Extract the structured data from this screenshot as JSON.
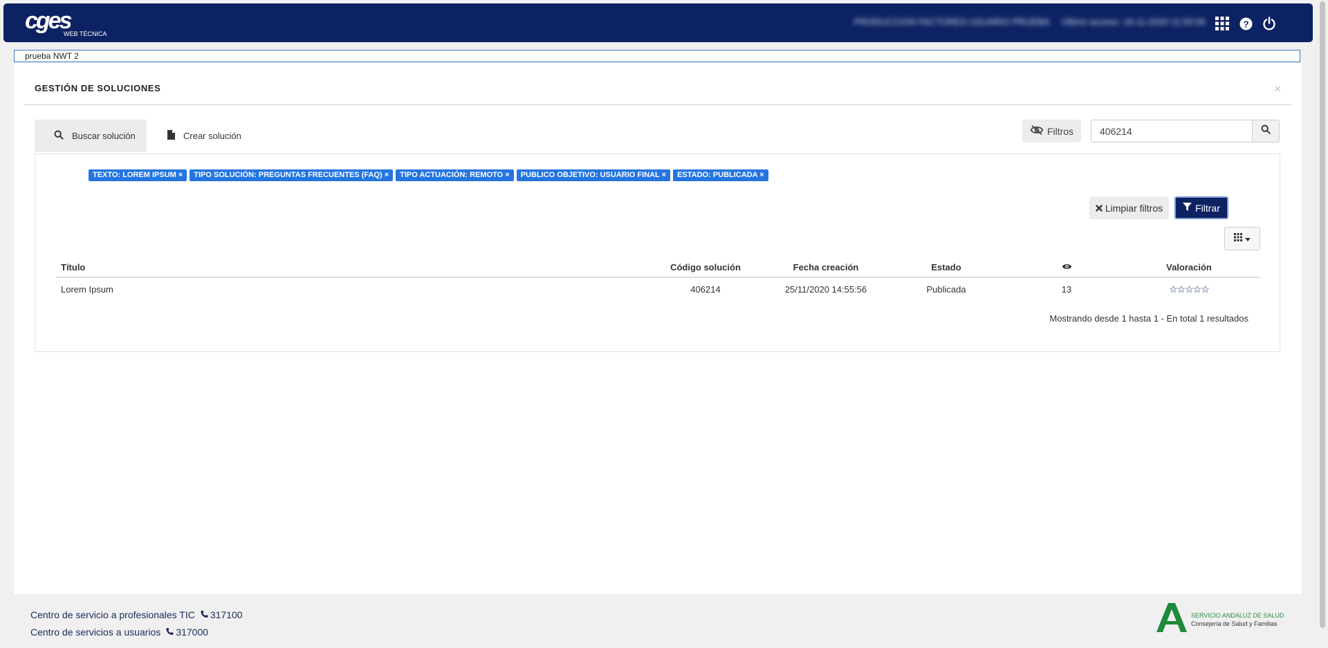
{
  "header": {
    "logo_text": "cges",
    "logo_subtext": "WEB TÉCNICA",
    "user_text": "PRODUCCION FACTORES USUARIO PRUEBA",
    "last_access_text": "Último acceso: 16-11-2020 11:50:56",
    "icons": [
      "apps-grid-icon",
      "help-icon",
      "power-icon"
    ]
  },
  "tabstrip": {
    "label": "prueba NWT 2"
  },
  "panel": {
    "title": "GESTIÓN DE SOLUCIONES",
    "close_label": "×",
    "tabs": [
      {
        "label": "Buscar solución",
        "icon": "search-icon",
        "active": true
      },
      {
        "label": "Crear solución",
        "icon": "document-icon",
        "active": false
      }
    ],
    "filters_button": "Filtros",
    "search_value": "406214",
    "search_placeholder": ""
  },
  "chips": [
    "TEXTO: LOREM IPSUM ×",
    "TIPO SOLUCIÓN: PREGUNTAS FRECUENTES (FAQ) ×",
    "TIPO ACTUACIÓN: REMOTO ×",
    "PUBLICO OBJETIVO: USUARIO FINAL ×",
    "ESTADO: PUBLICADA ×"
  ],
  "actions": {
    "clear_label": "Limpiar filtros",
    "filter_label": "Filtrar"
  },
  "table": {
    "columns": [
      "Título",
      "Código solución",
      "Fecha creación",
      "Estado",
      "",
      "Valoración"
    ],
    "views_icon": "eye-icon",
    "rows": [
      {
        "title": "Lorem Ipsum",
        "code": "406214",
        "date": "25/11/2020 14:55:56",
        "state": "Publicada",
        "views": "13",
        "rating": "☆☆☆☆☆",
        "rating_value": 0,
        "rating_max": 5
      }
    ],
    "pager_info": "Mostrando desde 1 hasta 1 - En total 1 resultados"
  },
  "footer": {
    "line1_label": "Centro de servicio a profesionales TIC",
    "line1_phone": "317100",
    "line2_label": "Centro de servicios a usuarios",
    "line2_phone": "317000",
    "org_line1": "SERVICIO ANDALUZ DE SALUD",
    "org_line2": "Consejería de Salud y Familias"
  },
  "colors": {
    "header_bg": "#0d2262",
    "chip_bg": "#2475e0",
    "filter_btn_bg": "#0d2262",
    "junta_green": "#1f8a3b"
  }
}
